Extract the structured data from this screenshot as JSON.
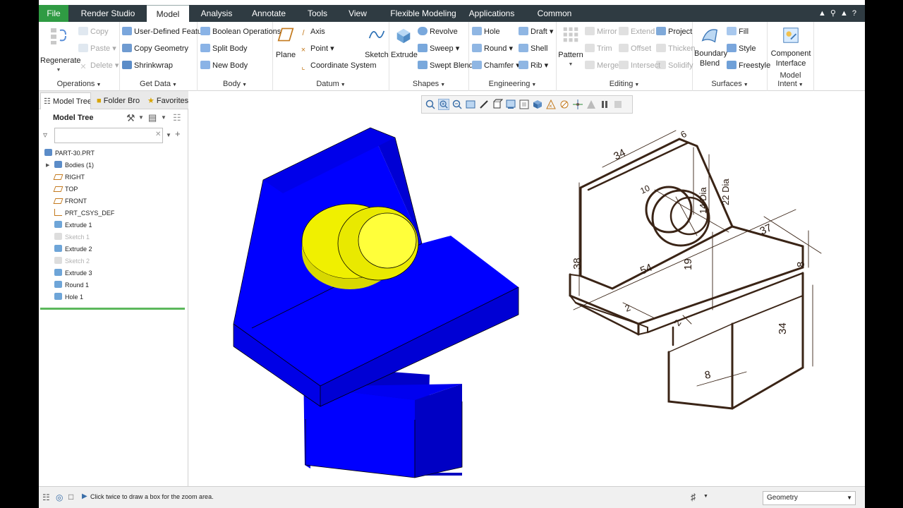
{
  "tabs": [
    "File",
    "Render Studio",
    "Model",
    "Analysis",
    "Annotate",
    "Tools",
    "View",
    "Flexible Modeling",
    "Applications",
    "Common"
  ],
  "ribbon": {
    "operations": {
      "regenerate": "Regenerate",
      "copy": "Copy",
      "paste": "Paste",
      "delete": "Delete",
      "label": "Operations"
    },
    "get_data": {
      "user_defined_feature": "User-Defined Feature",
      "copy_geometry": "Copy Geometry",
      "shrinkwrap": "Shrinkwrap",
      "label": "Get Data"
    },
    "body": {
      "boolean_operations": "Boolean Operations",
      "split_body": "Split Body",
      "new_body": "New Body",
      "label": "Body"
    },
    "datum": {
      "plane": "Plane",
      "axis": "Axis",
      "point": "Point",
      "coordinate_system": "Coordinate System",
      "sketch": "Sketch",
      "label": "Datum"
    },
    "shapes": {
      "extrude": "Extrude",
      "revolve": "Revolve",
      "sweep": "Sweep",
      "swept_blend": "Swept Blend",
      "label": "Shapes"
    },
    "engineering": {
      "hole": "Hole",
      "round": "Round",
      "chamfer": "Chamfer",
      "draft": "Draft",
      "shell": "Shell",
      "rib": "Rib",
      "label": "Engineering"
    },
    "editing": {
      "pattern": "Pattern",
      "mirror": "Mirror",
      "trim": "Trim",
      "merge": "Merge",
      "extend": "Extend",
      "offset": "Offset",
      "intersect": "Intersect",
      "project": "Project",
      "thicken": "Thicken",
      "solidify": "Solidify",
      "label": "Editing"
    },
    "surfaces": {
      "boundary_blend_line1": "Boundary",
      "boundary_blend_line2": "Blend",
      "fill": "Fill",
      "style": "Style",
      "freestyle": "Freestyle",
      "label": "Surfaces"
    },
    "model_intent": {
      "component_interface_line1": "Component",
      "component_interface_line2": "Interface",
      "label": "Model Intent"
    }
  },
  "navigator": {
    "tabs": [
      "Model Tree",
      "Folder Bro",
      "Favorites"
    ],
    "title": "Model Tree",
    "filter_placeholder": "",
    "tree": [
      {
        "label": "PART-30.PRT",
        "icon": "part-icon",
        "dim": false
      },
      {
        "label": "Bodies (1)",
        "icon": "bodies-icon",
        "dim": false
      },
      {
        "label": "RIGHT",
        "icon": "datum-plane-icon",
        "dim": false
      },
      {
        "label": "TOP",
        "icon": "datum-plane-icon",
        "dim": false
      },
      {
        "label": "FRONT",
        "icon": "datum-plane-icon",
        "dim": false
      },
      {
        "label": "PRT_CSYS_DEF",
        "icon": "csys-icon",
        "dim": false
      },
      {
        "label": "Extrude 1",
        "icon": "extrude-icon",
        "dim": false
      },
      {
        "label": "Sketch 1",
        "icon": "sketch-icon",
        "dim": true
      },
      {
        "label": "Extrude 2",
        "icon": "extrude-icon",
        "dim": false
      },
      {
        "label": "Sketch 2",
        "icon": "sketch-icon",
        "dim": true
      },
      {
        "label": "Extrude 3",
        "icon": "extrude-icon",
        "dim": false
      },
      {
        "label": "Round 1",
        "icon": "round-icon",
        "dim": false
      },
      {
        "label": "Hole 1",
        "icon": "hole-icon",
        "dim": false
      }
    ]
  },
  "drawing_dims": {
    "d34_top": "34",
    "d6": "6",
    "d10": "10",
    "d14": "14 Dia",
    "d22": "22 Dia",
    "d38": "38",
    "d54": "54",
    "d19": "19",
    "d37": "37",
    "d8_right": "8",
    "d2_a": "2",
    "d2_b": "2",
    "d34_right": "34",
    "d8_bottom": "8"
  },
  "status": {
    "message": "Click twice to draw a box for the zoom area.",
    "filter_value": "Geometry"
  },
  "colors": {
    "model_blue": "#0000f5",
    "boss_yellow": "#f0f000",
    "file_tab_green": "#2f9b43",
    "tabbar_dark": "#2f3b42"
  }
}
